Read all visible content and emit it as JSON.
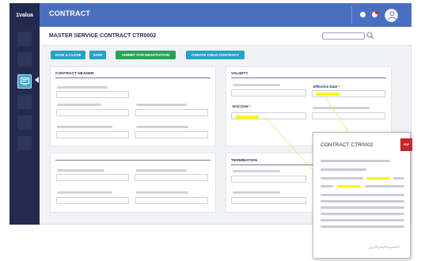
{
  "sidebar": {
    "brand": "1valua"
  },
  "topbar": {
    "title": "CONTRACT"
  },
  "page": {
    "title": "MASTER SERVICE CONTRACT CTR0002"
  },
  "search": {
    "placeholder": ""
  },
  "actions": {
    "save_close": "SAVE & CLOSE",
    "save": "SAVE",
    "submit": "SUBMIT FOR NEGOTIATION",
    "create_child": "CREATE CHILD CONTRACT"
  },
  "sections": {
    "contract_header": "CONTRACT HEADER",
    "validity": "VALIDITY",
    "termination": "TERMINATION"
  },
  "fields": {
    "effective_date": "Effective Date",
    "end_date": "End Date",
    "required_mark": "*"
  },
  "document": {
    "title": "CONTRACT CTR0002",
    "badge": "PDF"
  },
  "colors": {
    "topbar": "#4a6fc1",
    "sidebar": "#232a4d",
    "primary_button": "#23a3c8",
    "success_button": "#24a455",
    "highlight": "#fff500",
    "pdf_badge": "#c1272d"
  },
  "icons": {
    "search": "search-icon",
    "user": "user-icon",
    "notification": "notification-icon",
    "active_module": "monitor-icon"
  }
}
